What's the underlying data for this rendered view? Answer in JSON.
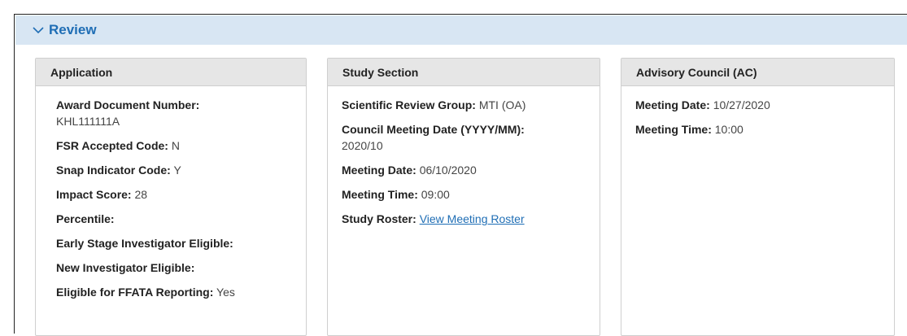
{
  "section": {
    "title": "Review",
    "icon": "chevron-down-icon"
  },
  "application": {
    "heading": "Application",
    "award_doc_label": "Award Document Number:",
    "award_doc_value": "KHL111111A",
    "fsr_label": "FSR Accepted Code:",
    "fsr_value": "N",
    "snap_label": "Snap Indicator Code:",
    "snap_value": "Y",
    "impact_label": "Impact Score:",
    "impact_value": "28",
    "percentile_label": "Percentile:",
    "percentile_value": "",
    "esi_label": "Early Stage Investigator Eligible:",
    "esi_value": "",
    "nie_label": "New Investigator Eligible:",
    "nie_value": "",
    "ffata_label": "Eligible for FFATA Reporting:",
    "ffata_value": "Yes"
  },
  "study_section": {
    "heading": "Study Section",
    "srg_label": "Scientific Review Group:",
    "srg_value": "MTI (OA)",
    "council_label": "Council Meeting Date (YYYY/MM):",
    "council_value": "2020/10",
    "meeting_date_label": "Meeting Date:",
    "meeting_date_value": "06/10/2020",
    "meeting_time_label": "Meeting Time:",
    "meeting_time_value": "09:00",
    "roster_label": "Study Roster:",
    "roster_link": "View Meeting Roster"
  },
  "advisory_council": {
    "heading": "Advisory Council (AC)",
    "meeting_date_label": "Meeting Date:",
    "meeting_date_value": "10/27/2020",
    "meeting_time_label": "Meeting Time:",
    "meeting_time_value": "10:00"
  },
  "colors": {
    "header_bg": "#d8e6f3",
    "accent": "#1f6eb5",
    "card_head_bg": "#e6e6e6"
  }
}
